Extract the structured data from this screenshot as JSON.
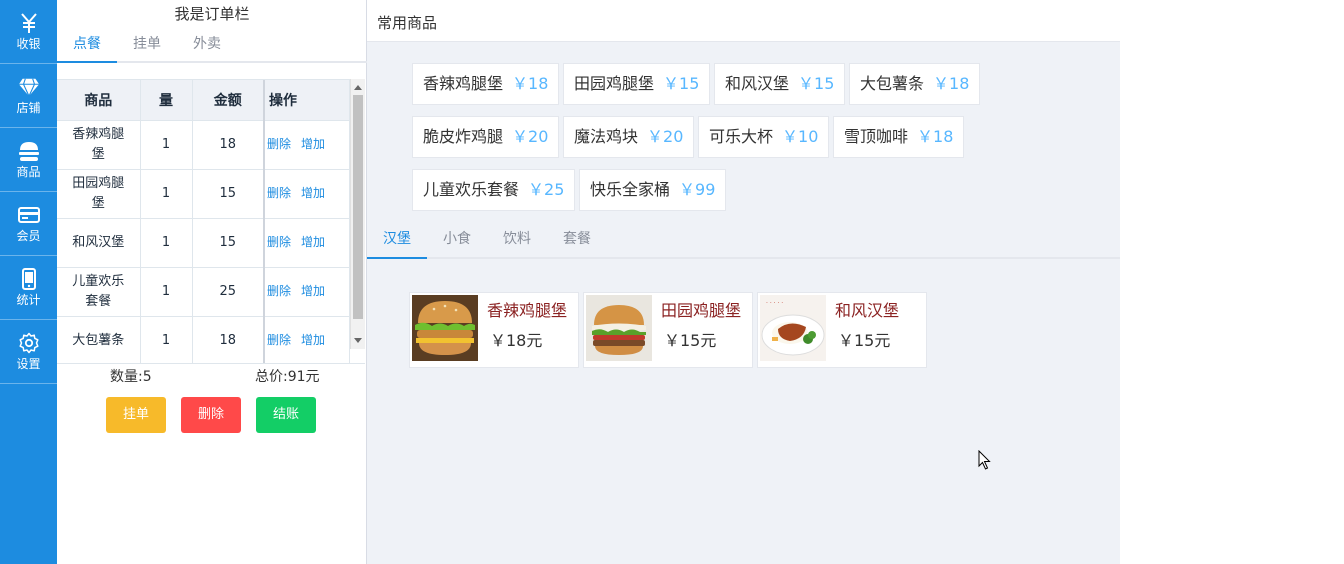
{
  "nav": {
    "items": [
      {
        "label": "收银",
        "icon": "yen-icon"
      },
      {
        "label": "店铺",
        "icon": "diamond-icon"
      },
      {
        "label": "商品",
        "icon": "burger-icon"
      },
      {
        "label": "会员",
        "icon": "card-icon"
      },
      {
        "label": "统计",
        "icon": "phone-icon"
      },
      {
        "label": "设置",
        "icon": "gear-icon"
      }
    ]
  },
  "order": {
    "title": "我是订单栏",
    "tabs": [
      "点餐",
      "挂单",
      "外卖"
    ],
    "active_tab": "点餐",
    "columns": [
      "商品",
      "量",
      "金额",
      "操作"
    ],
    "rows": [
      {
        "name": "香辣鸡腿堡",
        "qty": "1",
        "amount": "18"
      },
      {
        "name": "田园鸡腿堡",
        "qty": "1",
        "amount": "15"
      },
      {
        "name": "和风汉堡",
        "qty": "1",
        "amount": "15"
      },
      {
        "name": "儿童欢乐套餐",
        "qty": "1",
        "amount": "25"
      },
      {
        "name": "大包薯条",
        "qty": "1",
        "amount": "18"
      }
    ],
    "delete_label": "删除",
    "add_label": "增加",
    "quantity_text": "数量:5",
    "total_text": "总价:91元",
    "buttons": {
      "hold": "挂单",
      "delete": "删除",
      "checkout": "结账"
    }
  },
  "common": {
    "title": "常用商品",
    "items": [
      {
        "name": "香辣鸡腿堡",
        "price": "￥18"
      },
      {
        "name": "田园鸡腿堡",
        "price": "￥15"
      },
      {
        "name": "和风汉堡",
        "price": "￥15"
      },
      {
        "name": "大包薯条",
        "price": "￥18"
      },
      {
        "name": "脆皮炸鸡腿",
        "price": "￥20"
      },
      {
        "name": "魔法鸡块",
        "price": "￥20"
      },
      {
        "name": "可乐大杯",
        "price": "￥10"
      },
      {
        "name": "雪顶咖啡",
        "price": "￥18"
      },
      {
        "name": "儿童欢乐套餐",
        "price": "￥25"
      },
      {
        "name": "快乐全家桶",
        "price": "￥99"
      }
    ]
  },
  "categories": {
    "tabs": [
      "汉堡",
      "小食",
      "饮料",
      "套餐"
    ],
    "active_tab": "汉堡"
  },
  "goods": [
    {
      "name": "香辣鸡腿堡",
      "price": "￥18元"
    },
    {
      "name": "田园鸡腿堡",
      "price": "￥15元"
    },
    {
      "name": "和风汉堡",
      "price": "￥15元"
    }
  ],
  "colors": {
    "nav_bg": "#1d8ce0",
    "accent": "#1d8ce0",
    "price_blue": "#58b7ff",
    "goods_name": "#8b2222",
    "btn_hold": "#f7ba2a",
    "btn_delete": "#ff4949",
    "btn_checkout": "#13ce66"
  }
}
